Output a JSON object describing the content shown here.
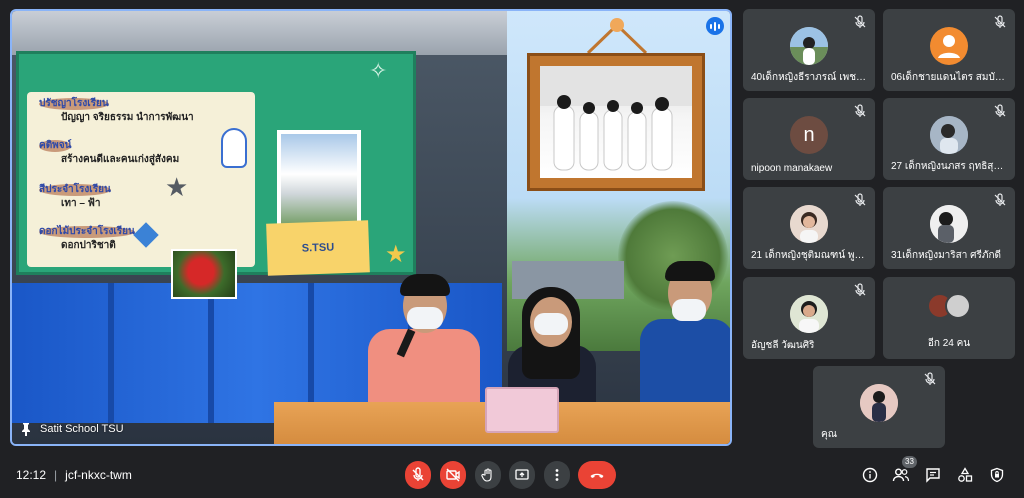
{
  "main_tile": {
    "presenter_label": "Satit School TSU",
    "slide": {
      "heading_1": "ปรัชญาโรงเรียน",
      "text_1": "ปัญญา จริยธรรม นำการพัฒนา",
      "heading_2": "คติพจน์",
      "text_2": "สร้างคนดีและคนเก่งสู่สังคม",
      "heading_3": "สีประจำโรงเรียน",
      "text_3": "เทา – ฟ้า",
      "heading_4": "ดอกไม้ประจำโรงเรียน",
      "text_4": "ดอกปาริชาติ",
      "photo_caption": "S.TSU"
    }
  },
  "participants": [
    {
      "name": "40เด็กหญิงธีราภรณ์ เพชรส...",
      "avatar_type": "photo",
      "avatar_color": "#b9c7d6",
      "muted": true
    },
    {
      "name": "06เด็กชายแดนไตร สมบัติบุญ",
      "avatar_type": "person-icon",
      "avatar_color": "#f28b30",
      "muted": true
    },
    {
      "name": "nipoon manakaew",
      "avatar_type": "letter",
      "avatar_letter": "n",
      "avatar_color": "#6d4c41",
      "muted": true
    },
    {
      "name": "27 เด็กหญิงนภสร ฤทธิสุนทร",
      "avatar_type": "photo",
      "avatar_color": "#8fa3b8",
      "muted": true
    },
    {
      "name": "21 เด็กหญิงชุติมณฑน์ พูลผล",
      "avatar_type": "photo",
      "avatar_color": "#d7c2b4",
      "muted": true
    },
    {
      "name": "31เด็กหญิงมาริสา ศรีภักดี",
      "avatar_type": "photo",
      "avatar_color": "#e4e4e4",
      "muted": true
    },
    {
      "name": "อัญชลี วัฒนศิริ",
      "avatar_type": "photo",
      "avatar_color": "#cfd8c4",
      "muted": true
    },
    {
      "name": "อีก 24 คน",
      "avatar_type": "stack",
      "avatar_color": "#8b3a2b",
      "muted": false
    },
    {
      "name": "คุณ",
      "avatar_type": "photo",
      "avatar_color": "#d8b7b0",
      "muted": true
    }
  ],
  "bottom_bar": {
    "time": "12:12",
    "divider": "|",
    "meeting_code": "jcf-nkxc-twm",
    "people_count": "33",
    "colors": {
      "danger": "#ea4335",
      "control_grey": "#3c4043"
    },
    "controls": [
      "mic-off-icon",
      "camera-off-icon",
      "raise-hand-icon",
      "present-icon",
      "more-options-icon",
      "leave-call-icon"
    ],
    "right_icons": [
      "info-icon",
      "people-icon",
      "chat-icon",
      "activities-icon",
      "host-controls-icon"
    ]
  }
}
